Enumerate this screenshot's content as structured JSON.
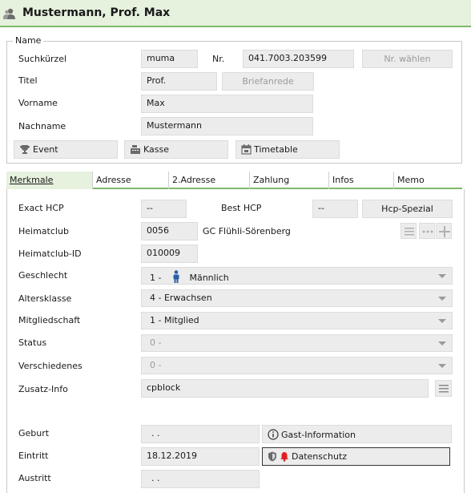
{
  "header": {
    "title": "Mustermann, Prof. Max",
    "icon": "person-icon"
  },
  "name_group": {
    "legend": "Name",
    "suchkuerzel_label": "Suchkürzel",
    "suchkuerzel_value": "muma",
    "nr_label": "Nr.",
    "nr_value": "041.7003.203599",
    "nr_waehlen": "Nr. wählen",
    "titel_label": "Titel",
    "titel_value": "Prof.",
    "briefanrede": "Briefanrede",
    "vorname_label": "Vorname",
    "vorname_value": "Max",
    "nachname_label": "Nachname",
    "nachname_value": "Mustermann",
    "event_button": "Event",
    "kasse_button": "Kasse",
    "timetable_button": "Timetable"
  },
  "tabs": [
    "Merkmale",
    "Adresse",
    "2.Adresse",
    "Zahlung",
    "Infos",
    "Memo"
  ],
  "merkmale": {
    "exact_hcp_label": "Exact HCP",
    "exact_hcp_value": "--",
    "best_hcp_label": "Best HCP",
    "best_hcp_value": "--",
    "hcp_spezial": "Hcp-Spezial",
    "heimatclub_label": "Heimatclub",
    "heimatclub_code": "0056",
    "heimatclub_name": "GC Flühli-Sörenberg",
    "heimatclub_id_label": "Heimatclub-ID",
    "heimatclub_id_value": "010009",
    "geschlecht_label": "Geschlecht",
    "geschlecht_prefix": "1 -",
    "geschlecht_value": "Männlich",
    "altersklasse_label": "Altersklasse",
    "altersklasse_value": "4 - Erwachsen",
    "mitgliedschaft_label": "Mitgliedschaft",
    "mitgliedschaft_value": "1 - Mitglied",
    "status_label": "Status",
    "status_value": "0 -",
    "verschiedenes_label": "Verschiedenes",
    "verschiedenes_value": "0 -",
    "zusatz_label": "Zusatz-Info",
    "zusatz_value": "cpblock",
    "geburt_label": "Geburt",
    "geburt_value": ". .",
    "gast_info": "Gast-Information",
    "eintritt_label": "Eintritt",
    "eintritt_value": "18.12.2019",
    "datenschutz": "Datenschutz",
    "austritt_label": "Austritt",
    "austritt_value": ". ."
  },
  "colors": {
    "accent": "#7fb86a",
    "header_bg": "#e6f1de",
    "field_bg": "#ececec",
    "bell": "#e02020",
    "gender_icon": "#2b5fa8"
  }
}
